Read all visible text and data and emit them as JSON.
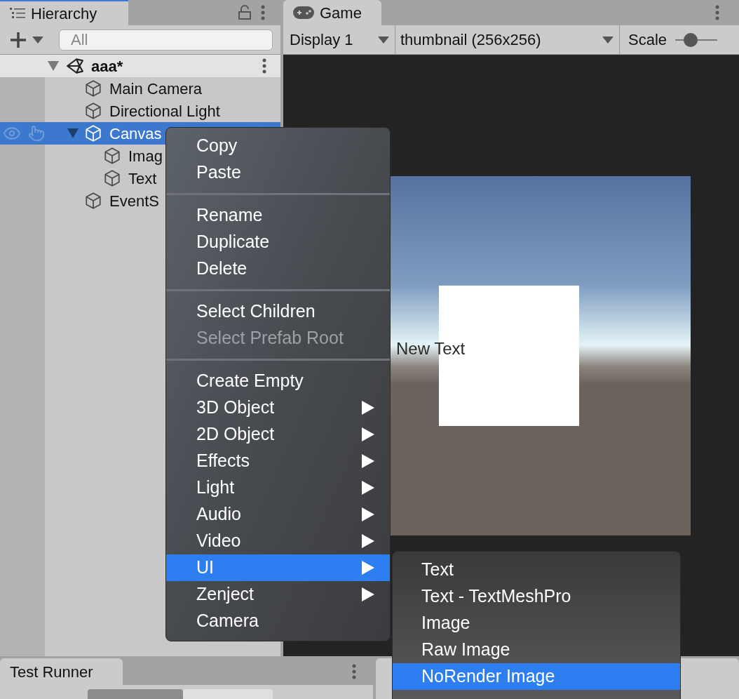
{
  "hierarchy": {
    "tab": "Hierarchy",
    "search": {
      "placeholder": "All"
    },
    "scene": {
      "name": "aaa*",
      "expanded": true
    },
    "items": [
      {
        "name": "Main Camera",
        "selected": false
      },
      {
        "name": "Directional Light",
        "selected": false
      },
      {
        "name": "Canvas",
        "selected": true,
        "expanded": true,
        "children": [
          {
            "name": "Imag",
            "selected": false
          },
          {
            "name": "Text",
            "selected": false
          }
        ]
      },
      {
        "name": "EventS",
        "selected": false
      }
    ]
  },
  "game": {
    "tab": "Game",
    "display": "Display 1",
    "resolution": "thumbnail (256x256)",
    "scale_label": "Scale",
    "scale": {
      "level": 0.3
    },
    "overlay_text": "New Text"
  },
  "context_menu": {
    "sections": [
      [
        {
          "label": "Copy",
          "kind": "item",
          "disabled": false,
          "selected": false
        },
        {
          "label": "Paste",
          "kind": "item",
          "disabled": false,
          "selected": false
        }
      ],
      [
        {
          "label": "Rename",
          "kind": "item",
          "disabled": false,
          "selected": false
        },
        {
          "label": "Duplicate",
          "kind": "item",
          "disabled": false,
          "selected": false
        },
        {
          "label": "Delete",
          "kind": "item",
          "disabled": false,
          "selected": false
        }
      ],
      [
        {
          "label": "Select Children",
          "kind": "item",
          "disabled": false,
          "selected": false
        },
        {
          "label": "Select Prefab Root",
          "kind": "item",
          "disabled": true,
          "selected": false
        }
      ],
      [
        {
          "label": "Create Empty",
          "kind": "item",
          "disabled": false,
          "selected": false
        },
        {
          "label": "3D Object",
          "kind": "submenu",
          "disabled": false,
          "selected": false
        },
        {
          "label": "2D Object",
          "kind": "submenu",
          "disabled": false,
          "selected": false
        },
        {
          "label": "Effects",
          "kind": "submenu",
          "disabled": false,
          "selected": false
        },
        {
          "label": "Light",
          "kind": "submenu",
          "disabled": false,
          "selected": false
        },
        {
          "label": "Audio",
          "kind": "submenu",
          "disabled": false,
          "selected": false
        },
        {
          "label": "Video",
          "kind": "submenu",
          "disabled": false,
          "selected": false
        },
        {
          "label": "UI",
          "kind": "submenu",
          "disabled": false,
          "selected": true
        },
        {
          "label": "Zenject",
          "kind": "submenu",
          "disabled": false,
          "selected": false
        },
        {
          "label": "Camera",
          "kind": "item",
          "disabled": false,
          "selected": false
        }
      ]
    ]
  },
  "submenu": {
    "items": [
      {
        "label": "Text",
        "selected": false
      },
      {
        "label": "Text - TextMeshPro",
        "selected": false
      },
      {
        "label": "Image",
        "selected": false
      },
      {
        "label": "Raw Image",
        "selected": false
      },
      {
        "label": "NoRender Image",
        "selected": true
      }
    ]
  },
  "bottom_panel": {
    "tab": "Test Runner"
  }
}
